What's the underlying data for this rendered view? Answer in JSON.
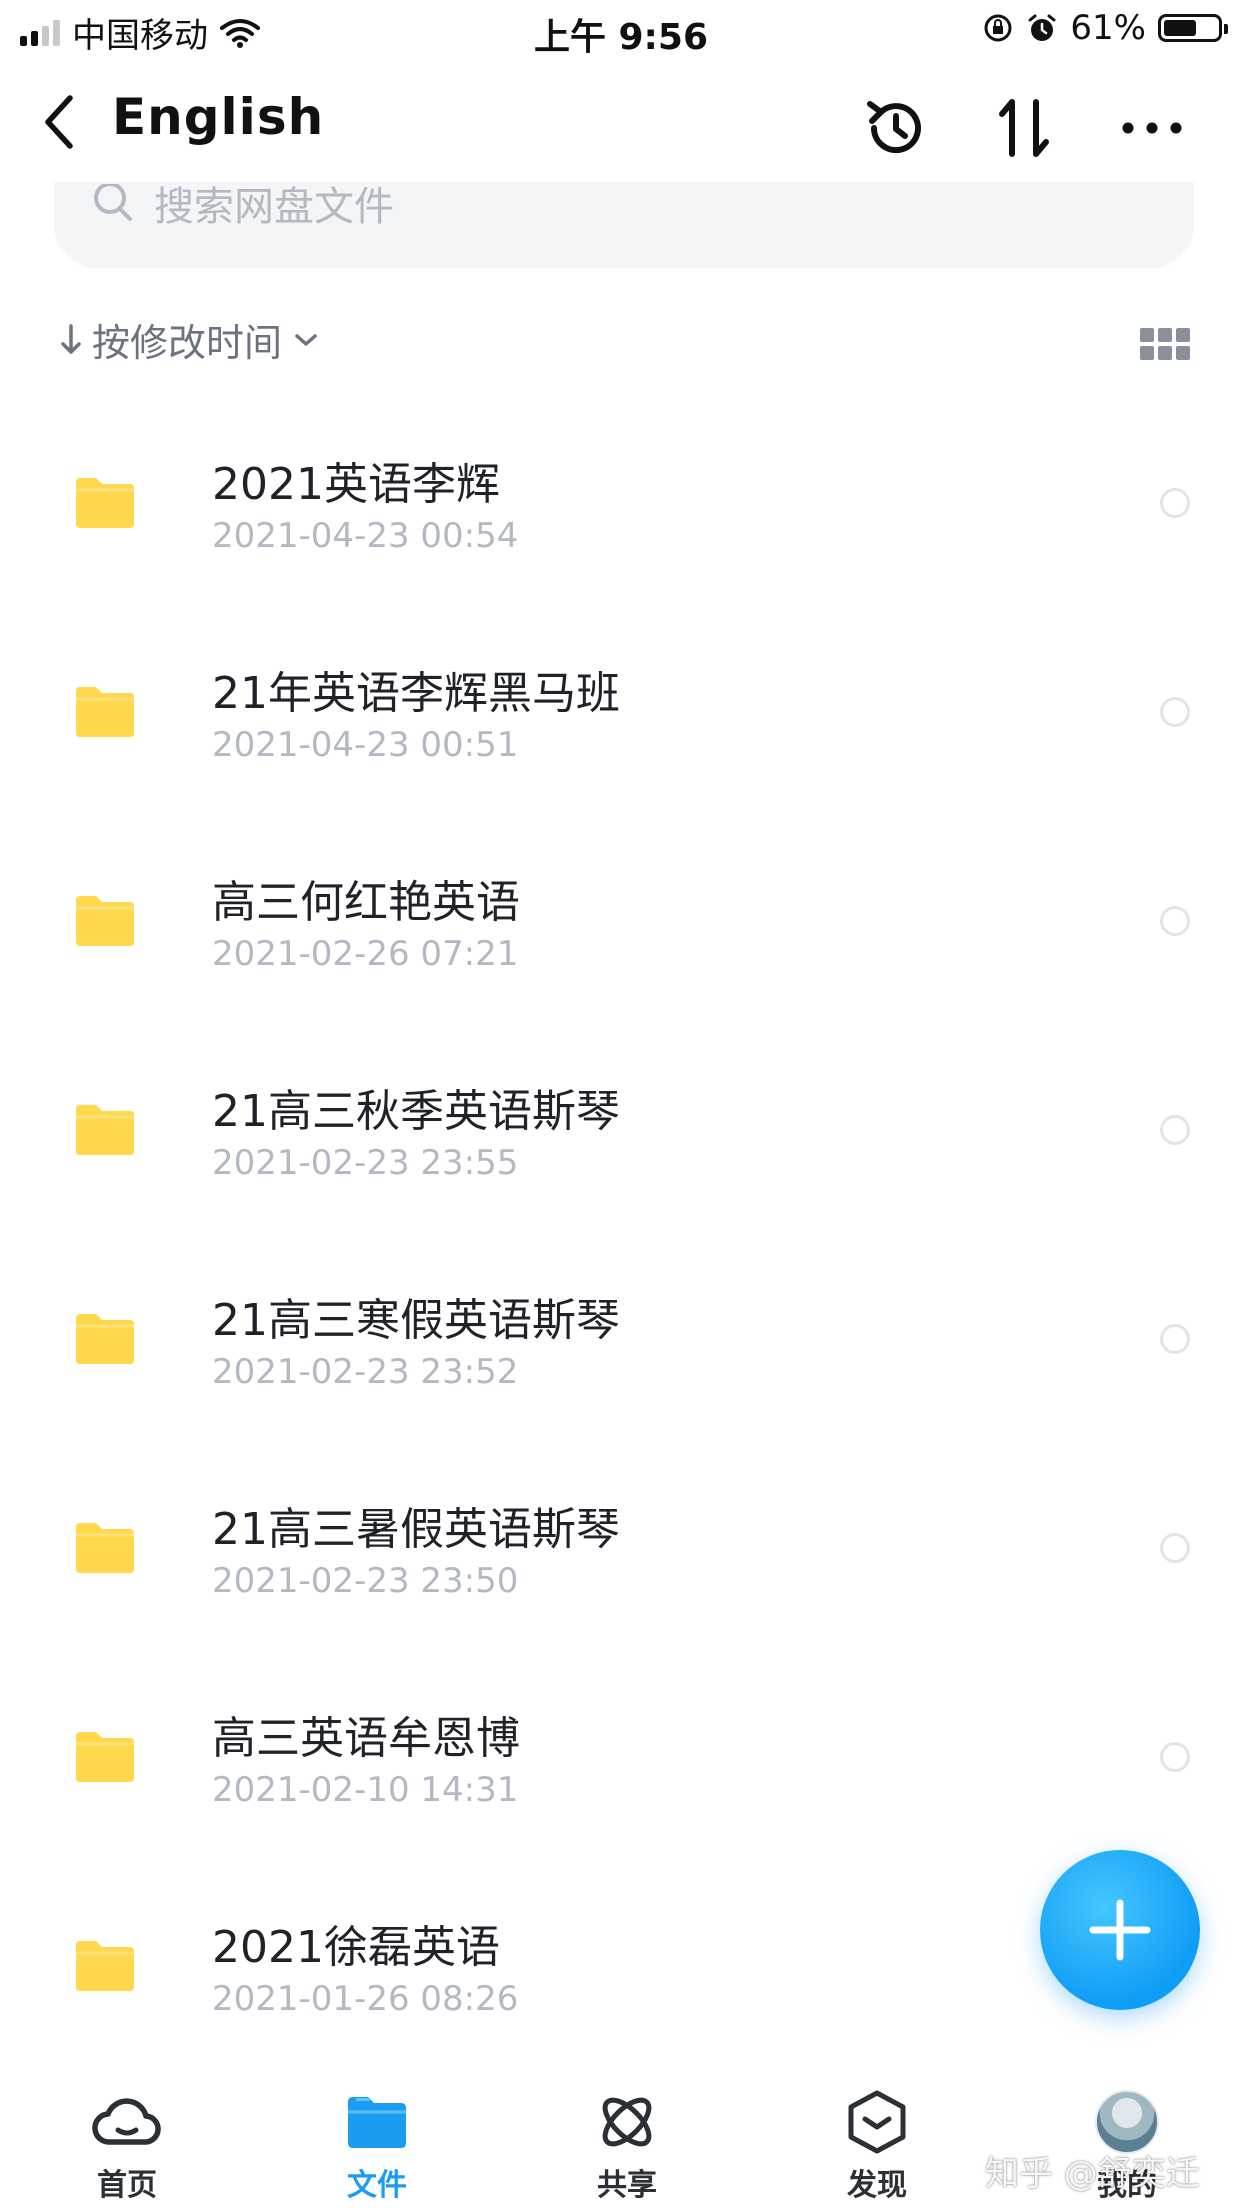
{
  "status_bar": {
    "carrier": "中国移动",
    "time": "上午 9:56",
    "battery_percent": "61%",
    "battery_level": 0.61,
    "icons": [
      "signal-icon",
      "wifi-icon",
      "orientation-lock-icon",
      "alarm-icon",
      "battery-icon"
    ]
  },
  "header": {
    "title": "English",
    "icons": [
      "back-icon",
      "history-icon",
      "sort-icon",
      "more-icon"
    ]
  },
  "search": {
    "placeholder": "搜索网盘文件"
  },
  "sort": {
    "label": "按修改时间",
    "icons": [
      "arrow-down-icon",
      "chevron-down-icon",
      "grid-view-icon"
    ]
  },
  "files": [
    {
      "name": "2021英语李辉",
      "date": "2021-04-23 00:54"
    },
    {
      "name": "21年英语李辉黑马班",
      "date": "2021-04-23 00:51"
    },
    {
      "name": "高三何红艳英语",
      "date": "2021-02-26 07:21"
    },
    {
      "name": "21高三秋季英语斯琴",
      "date": "2021-02-23 23:55"
    },
    {
      "name": "21高三寒假英语斯琴",
      "date": "2021-02-23 23:52"
    },
    {
      "name": "21高三暑假英语斯琴",
      "date": "2021-02-23 23:50"
    },
    {
      "name": "高三英语牟恩博",
      "date": "2021-02-10 14:31"
    },
    {
      "name": "2021徐磊英语",
      "date": "2021-01-26 08:26"
    }
  ],
  "tabs": [
    {
      "label": "首页",
      "icon": "cloud-icon",
      "active": false
    },
    {
      "label": "文件",
      "icon": "folder-icon",
      "active": true
    },
    {
      "label": "共享",
      "icon": "share-orbit-icon",
      "active": false
    },
    {
      "label": "发现",
      "icon": "discover-icon",
      "active": false
    },
    {
      "label": "我的",
      "icon": "avatar",
      "active": false
    }
  ],
  "watermark": "知乎 @舒奕迁",
  "colors": {
    "accent": "#1a9cf0",
    "folder": "#ffd84d",
    "secondary_text": "#b3b8c2"
  }
}
